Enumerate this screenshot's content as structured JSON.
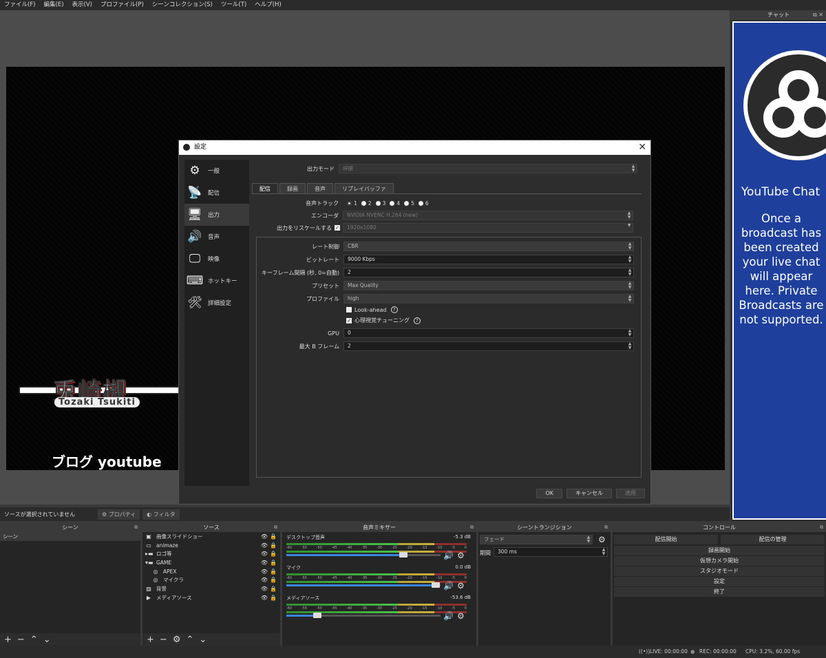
{
  "menu": [
    "ファイル(F)",
    "編集(E)",
    "表示(V)",
    "プロファイル(P)",
    "シーンコレクション(S)",
    "ツール(T)",
    "ヘルプ(H)"
  ],
  "preview": {
    "logo_text": "兎崎槻",
    "logo_sub": "Tozaki Tsukiti",
    "bottom_text": "ブログ youtube"
  },
  "chat": {
    "header": "チャット",
    "title": "YouTube Chat",
    "description": "Once a broadcast has been created your live chat will appear here. Private Broadcasts are not supported."
  },
  "settings": {
    "title": "設定",
    "close_glyph": "✕",
    "sidebar": [
      {
        "label": "一般",
        "icon": "gear-icon",
        "glyph": "⚙"
      },
      {
        "label": "配信",
        "icon": "antenna-icon",
        "glyph": "📡"
      },
      {
        "label": "出力",
        "icon": "output-icon",
        "glyph": "🖥"
      },
      {
        "label": "音声",
        "icon": "speaker-icon",
        "glyph": "🔊"
      },
      {
        "label": "映像",
        "icon": "monitor-icon",
        "glyph": "🖵"
      },
      {
        "label": "ホットキー",
        "icon": "keyboard-icon",
        "glyph": "⌨"
      },
      {
        "label": "詳細設定",
        "icon": "tools-icon",
        "glyph": "🛠"
      }
    ],
    "output_mode_label": "出力モード",
    "output_mode_value": "詳細",
    "tabs": [
      "配信",
      "録画",
      "音声",
      "リプレイバッファ"
    ],
    "audio_track_label": "音声トラック",
    "tracks": [
      "1",
      "2",
      "3",
      "4",
      "5",
      "6"
    ],
    "encoder_label": "エンコーダ",
    "encoder_value": "NVIDIA NVENC H.264 (new)",
    "rescale_label": "出力をリスケールする",
    "rescale_value": "1920x1080",
    "rate_control_label": "レート制御",
    "rate_control_value": "CBR",
    "bitrate_label": "ビットレート",
    "bitrate_value": "9000 Kbps",
    "keyframe_label": "キーフレーム間隔 (秒, 0=自動)",
    "keyframe_value": "2",
    "preset_label": "プリセット",
    "preset_value": "Max Quality",
    "profile_label": "プロファイル",
    "profile_value": "high",
    "lookahead_label": "Look-ahead",
    "psycho_label": "心理視覚チューニング",
    "gpu_label": "GPU",
    "gpu_value": "0",
    "bframes_label": "最大 B フレーム",
    "bframes_value": "2",
    "ok": "OK",
    "cancel": "キャンセル",
    "apply": "適用"
  },
  "source_toolbar": {
    "no_source": "ソースが選択されていません",
    "properties": "プロパティ",
    "filters": "フィルタ"
  },
  "docks": {
    "scenes": {
      "title": "シーン",
      "items": [
        "シーン"
      ]
    },
    "sources": {
      "title": "ソース",
      "items": [
        {
          "label": "画像スライドショー",
          "icon": "slideshow-icon",
          "glyph": "▣",
          "indent": 0
        },
        {
          "label": "animaze",
          "icon": "window-icon",
          "glyph": "▭",
          "indent": 0
        },
        {
          "label": "ロゴ等",
          "icon": "folder-icon",
          "glyph": "▸▬",
          "indent": 0
        },
        {
          "label": "GAME",
          "icon": "folder-icon",
          "glyph": "▾▬",
          "indent": 0
        },
        {
          "label": "APEX",
          "icon": "gamepad-icon",
          "glyph": "◎",
          "indent": 1
        },
        {
          "label": "マイクラ",
          "icon": "gamepad-icon",
          "glyph": "◎",
          "indent": 1
        },
        {
          "label": "背景",
          "icon": "image-icon",
          "glyph": "▨",
          "indent": 0
        },
        {
          "label": "メディアソース",
          "icon": "play-icon",
          "glyph": "▶",
          "indent": 0
        }
      ]
    },
    "mixer": {
      "title": "音声ミキサー",
      "channels": [
        {
          "name": "デスクトップ音声",
          "db": "-5.3 dB",
          "level": 0.76
        },
        {
          "name": "マイク",
          "db": "0.0 dB",
          "level": 0.97
        },
        {
          "name": "メディアソース",
          "db": "-53.6 dB",
          "level": 0.2
        }
      ],
      "scale": [
        "-60",
        "-55",
        "-50",
        "-45",
        "-40",
        "-35",
        "-30",
        "-25",
        "-20",
        "-15",
        "-10",
        "-5",
        "0"
      ]
    },
    "transitions": {
      "title": "シーントランジション",
      "fade": "フェード",
      "duration_label": "期間",
      "duration_value": "300 ms"
    },
    "controls": {
      "title": "コントロール",
      "start_stream": "配信開始",
      "manage": "配信の管理",
      "start_rec": "録画開始",
      "virtual_cam": "仮想カメラ開始",
      "studio": "スタジオモード",
      "settings": "設定",
      "exit": "終了"
    }
  },
  "status": {
    "live": "LIVE: 00:00:00",
    "rec": "REC: 00:00:00",
    "cpu": "CPU: 3.2%, 60.00 fps"
  }
}
